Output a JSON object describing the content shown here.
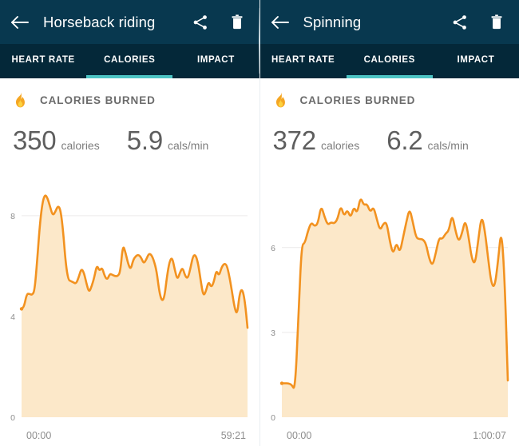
{
  "theme": {
    "appbar_bg": "#08384f",
    "tabbar_bg": "#042839",
    "accent_teal": "#4cc3c3",
    "line_orange": "#f29220",
    "fill_orange": "#fce8c9",
    "text_grey": "#6b6b6b"
  },
  "panels": [
    {
      "id": "horseback",
      "appbar": {
        "back_icon": "arrow-left-icon",
        "title": "Horseback riding",
        "share_icon": "share-icon",
        "delete_icon": "trash-icon"
      },
      "tabs": [
        {
          "label": "HEART RATE",
          "active": false
        },
        {
          "label": "CALORIES",
          "active": true
        },
        {
          "label": "IMPACT",
          "active": false
        }
      ],
      "card": {
        "icon": "flame-icon",
        "title": "CALORIES BURNED",
        "stats": [
          {
            "value": "350",
            "unit": "calories"
          },
          {
            "value": "5.9",
            "unit": "cals/min"
          }
        ]
      },
      "chart_data": {
        "type": "area",
        "title": "CALORIES BURNED",
        "xlabel": "",
        "ylabel": "cals/min",
        "ylim": [
          0,
          9.2
        ],
        "yticks": [
          0,
          4,
          8
        ],
        "ytick_labels": [
          "0",
          "4",
          "8"
        ],
        "grid": true,
        "x_start_label": "00:00",
        "x_end_label": "59:21",
        "duration_seconds": 3561,
        "line_color": "#f29220",
        "fill_color": "#fce8c9",
        "values": [
          4.3,
          4.4,
          4.9,
          4.9,
          4.85,
          5.0,
          6.2,
          7.6,
          8.5,
          8.85,
          8.7,
          8.35,
          8.0,
          8.15,
          8.4,
          8.25,
          7.4,
          6.1,
          5.45,
          5.4,
          5.35,
          5.3,
          5.55,
          5.9,
          5.75,
          5.3,
          4.95,
          5.2,
          5.55,
          6.05,
          5.8,
          5.95,
          5.6,
          5.45,
          5.7,
          5.65,
          5.6,
          5.6,
          5.75,
          6.85,
          6.55,
          6.1,
          5.85,
          6.25,
          6.4,
          6.45,
          6.35,
          6.1,
          6.25,
          6.5,
          6.45,
          6.2,
          5.8,
          5.0,
          4.6,
          4.75,
          5.6,
          6.2,
          6.35,
          5.85,
          5.45,
          5.75,
          5.95,
          5.6,
          5.5,
          5.9,
          6.4,
          6.45,
          6.1,
          5.4,
          4.8,
          5.0,
          5.4,
          5.15,
          5.35,
          5.85,
          5.6,
          5.95,
          6.1,
          6.05,
          5.6,
          5.0,
          4.35,
          4.05,
          4.95,
          5.1,
          4.6,
          3.55
        ]
      }
    },
    {
      "id": "spinning",
      "appbar": {
        "back_icon": "arrow-left-icon",
        "title": "Spinning",
        "share_icon": "share-icon",
        "delete_icon": "trash-icon"
      },
      "tabs": [
        {
          "label": "HEART RATE",
          "active": false
        },
        {
          "label": "CALORIES",
          "active": true
        },
        {
          "label": "IMPACT",
          "active": false
        }
      ],
      "card": {
        "icon": "flame-icon",
        "title": "CALORIES BURNED",
        "stats": [
          {
            "value": "372",
            "unit": "calories"
          },
          {
            "value": "6.2",
            "unit": "cals/min"
          }
        ]
      },
      "chart_data": {
        "type": "area",
        "title": "CALORIES BURNED",
        "xlabel": "",
        "ylabel": "cals/min",
        "ylim": [
          0,
          8.2
        ],
        "yticks": [
          0,
          3,
          6
        ],
        "ytick_labels": [
          "0",
          "3",
          "6"
        ],
        "grid": true,
        "x_start_label": "00:00",
        "x_end_label": "1:00:07",
        "duration_seconds": 3607,
        "line_color": "#f29220",
        "fill_color": "#fce8c9",
        "values": [
          1.2,
          1.2,
          1.2,
          1.15,
          0.95,
          3.3,
          6.1,
          6.15,
          6.6,
          6.9,
          6.75,
          6.85,
          7.5,
          7.1,
          6.8,
          6.9,
          6.85,
          7.0,
          7.5,
          7.1,
          7.35,
          7.05,
          7.45,
          7.2,
          7.8,
          7.5,
          7.55,
          7.25,
          7.45,
          7.0,
          6.6,
          6.85,
          6.9,
          6.2,
          5.75,
          6.2,
          5.8,
          6.35,
          6.9,
          7.4,
          6.9,
          6.35,
          6.3,
          6.3,
          6.15,
          5.6,
          5.35,
          5.8,
          6.35,
          6.3,
          6.5,
          6.6,
          7.2,
          6.6,
          6.2,
          6.5,
          7.0,
          6.4,
          5.6,
          5.4,
          6.3,
          7.15,
          6.6,
          5.6,
          4.7,
          4.6,
          5.5,
          6.7,
          5.0,
          1.3
        ]
      }
    }
  ]
}
